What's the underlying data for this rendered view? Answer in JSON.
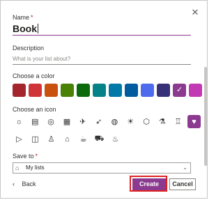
{
  "dialog": {
    "close_icon": "close-icon"
  },
  "name": {
    "label": "Name",
    "required": "*",
    "value": "Book"
  },
  "description": {
    "label": "Description",
    "placeholder": "What is your list about?"
  },
  "color": {
    "label": "Choose a color",
    "swatches": [
      "#a4262c",
      "#d13438",
      "#ca5010",
      "#498205",
      "#0b6a0b",
      "#038387",
      "#0078a8",
      "#005b9f",
      "#4f6bed",
      "#373277",
      "#8b3a8f",
      "#c239b3"
    ],
    "selected_index": 10
  },
  "icon": {
    "label": "Choose an icon",
    "row1": [
      "bug-icon",
      "document-icon",
      "target-icon",
      "calendar-icon",
      "airplane-icon",
      "rocket-icon",
      "palette-icon",
      "lightbulb-icon",
      "box-icon",
      "flask-icon",
      "dumbbell-icon",
      "piggybank-icon"
    ],
    "row2": [
      "play-icon",
      "camera-icon",
      "person-icon",
      "building-icon",
      "coffee-icon",
      "car-icon",
      "cake-icon"
    ],
    "row1_glyphs": [
      "☼",
      "▤",
      "◎",
      "▦",
      "✈",
      "➶",
      "◍",
      "☀",
      "⬡",
      "⚗",
      "♖",
      "♥"
    ],
    "row2_glyphs": [
      "▷",
      "◫",
      "♙",
      "⌂",
      "☕",
      "⛟",
      "♨"
    ],
    "selected": "piggybank-icon"
  },
  "save_to": {
    "label": "Save to",
    "required": "*",
    "value": "My lists"
  },
  "footer": {
    "back_label": "Back",
    "create_label": "Create",
    "cancel_label": "Cancel"
  }
}
